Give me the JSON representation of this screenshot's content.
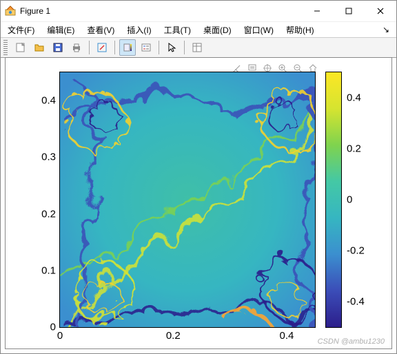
{
  "window": {
    "title": "Figure 1"
  },
  "menus": {
    "file": "文件(F)",
    "edit": "编辑(E)",
    "view": "查看(V)",
    "insert": "插入(I)",
    "tools": "工具(T)",
    "desktop": "桌面(D)",
    "window": "窗口(W)",
    "help": "帮助(H)",
    "more": "↘"
  },
  "toolbar": {
    "new": "new-figure",
    "open": "open",
    "save": "save",
    "print": "print",
    "edit_plot": "edit-plot",
    "link": "link",
    "insert_colorbar": "colorbar",
    "insert_legend": "legend",
    "cursor": "cursor",
    "props": "properties"
  },
  "axes_tools": {
    "brush": "brush",
    "datatip": "datatip",
    "pan": "pan",
    "zoom_in": "zoom-in",
    "zoom_out": "zoom-out",
    "home": "home"
  },
  "chart_data": {
    "type": "heatmap",
    "title": "",
    "xlabel": "",
    "ylabel": "",
    "xlim": [
      0,
      0.45
    ],
    "ylim": [
      0,
      0.45
    ],
    "xticks": [
      0,
      0.2,
      0.4
    ],
    "yticks": [
      0,
      0.1,
      0.2,
      0.3,
      0.4
    ],
    "xtick_labels": [
      "0",
      "0.2",
      "0.4"
    ],
    "ytick_labels": [
      "0",
      "0.1",
      "0.2",
      "0.3",
      "0.4"
    ],
    "colormap": "parula",
    "clim": [
      -0.5,
      0.5
    ],
    "colorbar_ticks": [
      -0.4,
      -0.2,
      0,
      0.2,
      0.4
    ],
    "colorbar_tick_labels": [
      "-0.4",
      "-0.2",
      "0",
      "0.2",
      "0.4"
    ],
    "description": "2D turbulence vorticity field with swirl structures; central region near 0, corner vortices reaching approx ±0.4."
  },
  "watermark": "CSDN @ambu1230"
}
